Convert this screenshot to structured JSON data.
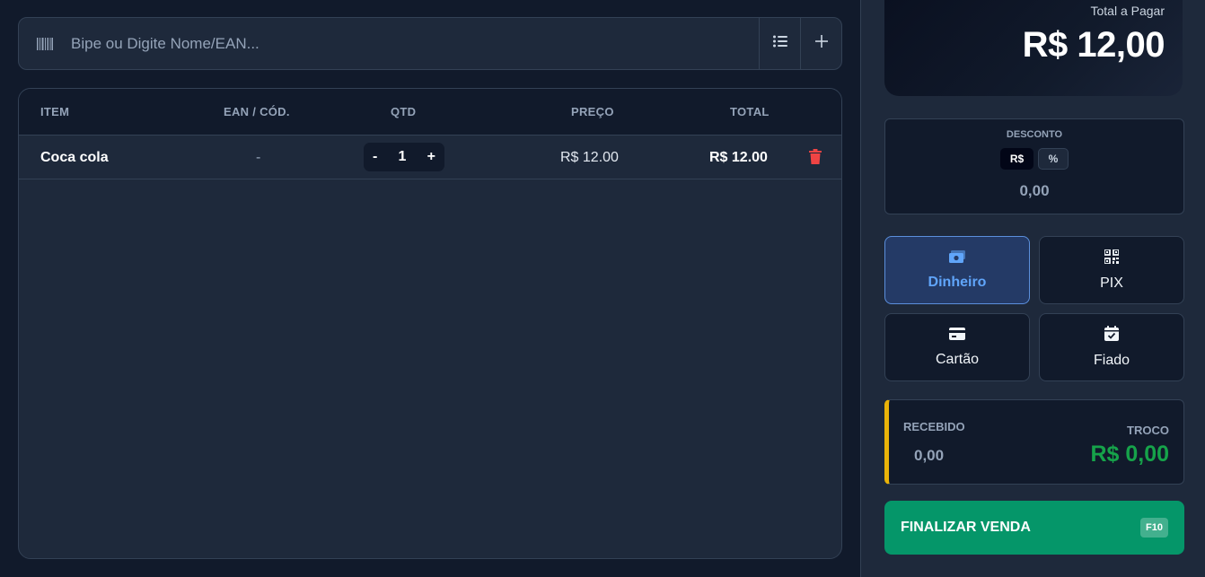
{
  "search": {
    "placeholder": "Bipe ou Digite Nome/EAN...",
    "barcode_icon": "barcode-icon",
    "list_icon": "list-icon",
    "add_icon": "plus-icon"
  },
  "cart": {
    "headers": {
      "item": "ITEM",
      "ean": "EAN / CÓD.",
      "qty": "QTD",
      "price": "PREÇO",
      "total": "TOTAL"
    },
    "rows": [
      {
        "item": "Coca cola",
        "ean": "-",
        "qty_minus": "-",
        "qty": "1",
        "qty_plus": "+",
        "price": "R$ 12.00",
        "total": "R$ 12.00",
        "delete_icon": "trash-icon"
      }
    ]
  },
  "summary": {
    "total_label": "Total a Pagar",
    "total_value": "R$ 12,00"
  },
  "discount": {
    "label": "DESCONTO",
    "mode_currency": "R$",
    "mode_percent": "%",
    "selected_mode": "R$",
    "value": "0,00"
  },
  "payment_methods": [
    {
      "label": "Dinheiro",
      "icon": "money-icon",
      "selected": true
    },
    {
      "label": "PIX",
      "icon": "qr-code-icon",
      "selected": false
    },
    {
      "label": "Cartão",
      "icon": "credit-card-icon",
      "selected": false
    },
    {
      "label": "Fiado",
      "icon": "calendar-check-icon",
      "selected": false
    }
  ],
  "change": {
    "received_label": "RECEBIDO",
    "received_value": "0,00",
    "change_label": "TROCO",
    "change_value": "R$ 0,00"
  },
  "finish": {
    "label": "FINALIZAR VENDA",
    "shortcut": "F10"
  },
  "colors": {
    "background": "#111a2b",
    "panel": "#1e293b",
    "accent_blue": "#60a5fa",
    "success_green": "#059669",
    "change_green": "#16a34a",
    "warning_yellow": "#eab308",
    "danger_red": "#ef4444"
  }
}
